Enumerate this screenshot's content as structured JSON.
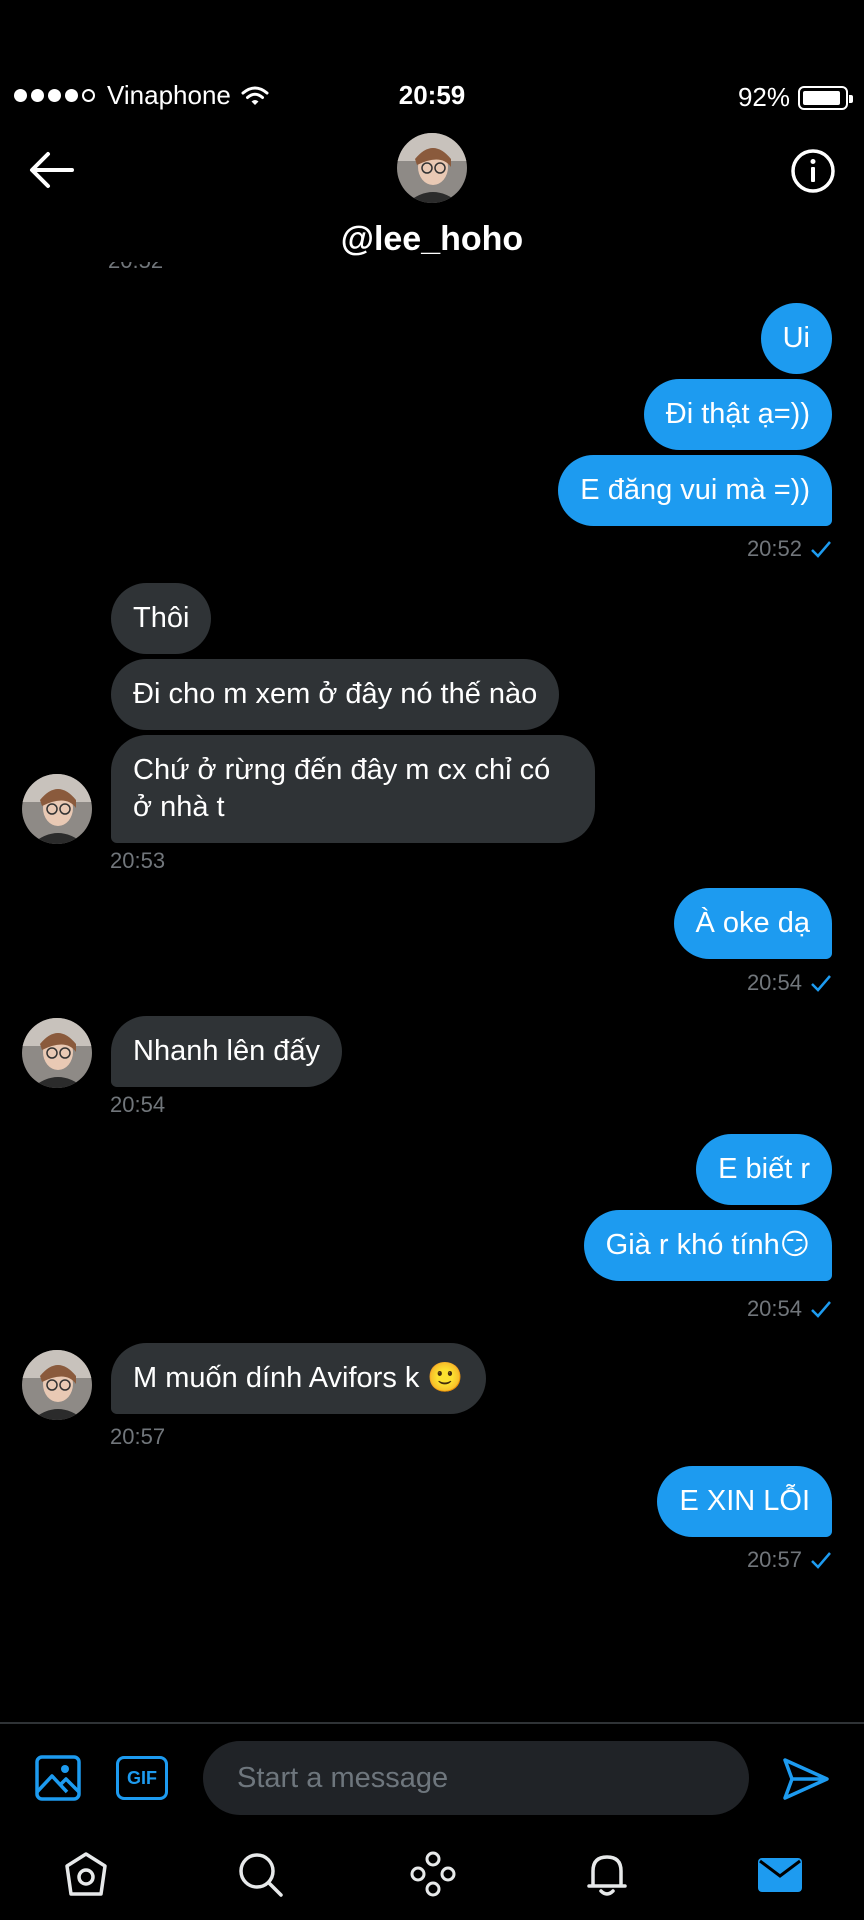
{
  "status_bar": {
    "carrier": "Vinaphone",
    "time": "20:59",
    "battery": "92%",
    "battery_level": 0.92
  },
  "header": {
    "username": "@lee_hoho",
    "partial_timestamp": "20:52"
  },
  "messages": [
    {
      "side": "sent",
      "text": "Ui"
    },
    {
      "side": "sent",
      "text": "Đi thật ạ=))"
    },
    {
      "side": "sent",
      "text": "E đăng vui mà =))"
    },
    {
      "side": "sent_time",
      "text": "20:52"
    },
    {
      "side": "recv",
      "text": "Thôi"
    },
    {
      "side": "recv",
      "text": "Đi cho m xem ở đây nó thế nào"
    },
    {
      "side": "recv",
      "line1": "Chứ ở rừng đến đây m cx chỉ có",
      "line2": "ở nhà t"
    },
    {
      "side": "recv_time",
      "text": "20:53"
    },
    {
      "side": "sent",
      "text": "À oke dạ"
    },
    {
      "side": "sent_time",
      "text": "20:54"
    },
    {
      "side": "recv",
      "text": "Nhanh lên đấy"
    },
    {
      "side": "recv_time",
      "text": "20:54"
    },
    {
      "side": "sent",
      "text": "E biết r"
    },
    {
      "side": "sent",
      "text": "Già r khó tính😏"
    },
    {
      "side": "sent_time",
      "text": "20:54"
    },
    {
      "side": "recv",
      "text": "M muốn dính Avifors k 🙂"
    },
    {
      "side": "recv_time",
      "text": "20:57"
    },
    {
      "side": "sent",
      "text": "E XIN LỖI"
    },
    {
      "side": "sent_time",
      "text": "20:57"
    }
  ],
  "composer": {
    "placeholder": "Start a message",
    "gif_label": "GIF"
  },
  "colors": {
    "accent": "#1d9bf0",
    "received_bubble": "#2f3336",
    "background": "#000000"
  },
  "icons": [
    "back-arrow-icon",
    "info-icon",
    "image-icon",
    "gif-icon",
    "send-icon",
    "home-icon",
    "search-icon",
    "spaces-icon",
    "notifications-icon",
    "messages-icon"
  ]
}
